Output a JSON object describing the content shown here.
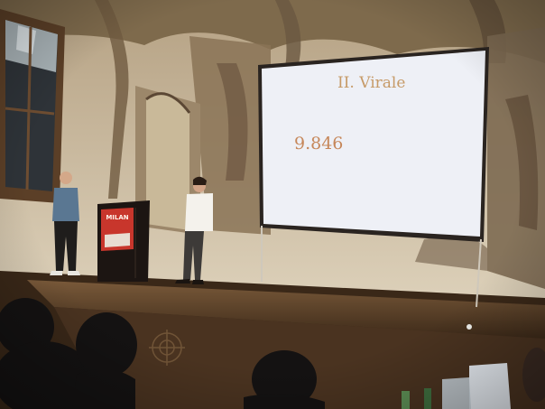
{
  "slide": {
    "title": "II. Virale",
    "number": "9.846"
  },
  "podium": {
    "city": "MILAN"
  },
  "colors": {
    "wall": "#d8cbb2",
    "fresco": "#8b7457",
    "stage": "#5a4129",
    "screen": "#eef0f6",
    "slide_text": "#c6875a",
    "podium_sign": "#c8362c"
  }
}
